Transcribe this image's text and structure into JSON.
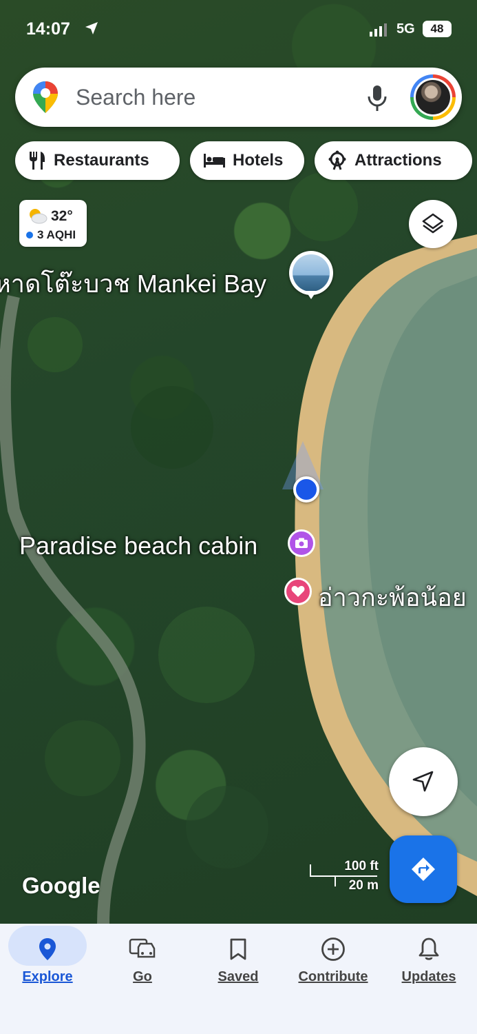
{
  "status_bar": {
    "time": "14:07",
    "network": "5G",
    "battery": "48"
  },
  "search": {
    "placeholder": "Search here"
  },
  "chips": [
    {
      "label": "Restaurants",
      "icon": "fork-knife-icon"
    },
    {
      "label": "Hotels",
      "icon": "bed-icon"
    },
    {
      "label": "Attractions",
      "icon": "ferris-wheel-icon"
    }
  ],
  "weather": {
    "temperature": "32°",
    "air_quality": "3 AQHI"
  },
  "map_labels": {
    "mankei_bay": "หาดโต๊ะบวช Mankei Bay",
    "paradise_cabin": "Paradise beach cabin",
    "ao_kapo_noi": "อ่าวกะพ้อน้อย"
  },
  "map": {
    "attribution": "Google",
    "scale_imperial": "100 ft",
    "scale_metric": "20 m"
  },
  "nav": {
    "items": [
      {
        "label": "Explore",
        "icon": "pin-icon",
        "active": true
      },
      {
        "label": "Go",
        "icon": "car-icon",
        "active": false
      },
      {
        "label": "Saved",
        "icon": "bookmark-icon",
        "active": false
      },
      {
        "label": "Contribute",
        "icon": "plus-circle-icon",
        "active": false
      },
      {
        "label": "Updates",
        "icon": "bell-icon",
        "active": false
      }
    ]
  },
  "colors": {
    "accent": "#1a73e8",
    "active_pill": "#d7e3fb",
    "photo_poi": "#b054e8",
    "saved_poi": "#e8457a"
  }
}
